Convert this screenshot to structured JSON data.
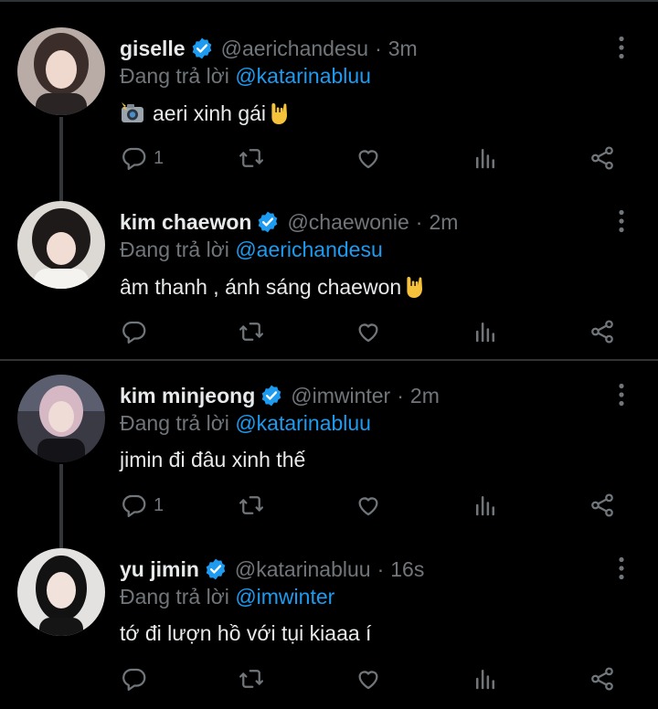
{
  "reply_prefix": "Đang trả lời",
  "tweets": [
    {
      "name": "giselle",
      "handle": "@aerichandesu",
      "time": "3m",
      "reply_to": "@katarinabluu",
      "text": "aeri xinh gái",
      "reply_count": "1",
      "avatar_tone": "#8a7f7a"
    },
    {
      "name": "kim chaewon",
      "handle": "@chaewonie",
      "time": "2m",
      "reply_to": "@aerichandesu",
      "text": "âm thanh , ánh sáng chaewon",
      "reply_count": "",
      "avatar_tone": "#c9c4bf"
    },
    {
      "name": "kim minjeong",
      "handle": "@imwinter",
      "time": "2m",
      "reply_to": "@katarinabluu",
      "text": "jimin đi đâu xinh thế",
      "reply_count": "1",
      "avatar_tone": "#4b4a52"
    },
    {
      "name": "yu jimin",
      "handle": "@katarinabluu",
      "time": "16s",
      "reply_to": "@imwinter",
      "text": "tớ đi lượn hồ với tụi kiaaa í",
      "reply_count": "",
      "avatar_tone": "#d8d6d4"
    }
  ],
  "colors": {
    "background": "#000000",
    "text_primary": "#e7e9ea",
    "text_secondary": "#71767b",
    "accent": "#1d9bf0",
    "divider": "#2f3336"
  },
  "icons": {
    "verified": "verified-badge-icon",
    "more": "more-vertical-icon",
    "reply": "reply-icon",
    "retweet": "retweet-icon",
    "like": "heart-icon",
    "views": "views-bar-chart-icon",
    "share": "share-icon",
    "camera_flash": "camera-flash-emoji",
    "rock_hand": "sign-of-horns-emoji"
  }
}
